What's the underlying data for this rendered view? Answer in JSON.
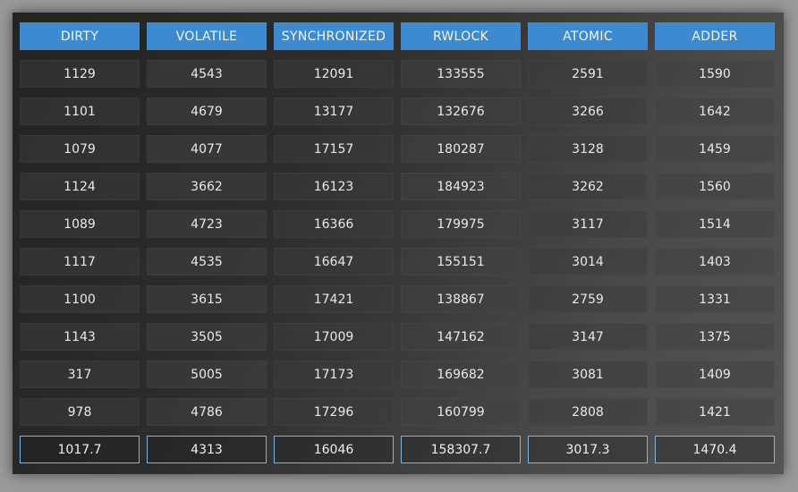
{
  "chart_data": {
    "type": "table",
    "columns": [
      "DIRTY",
      "VOLATILE",
      "SYNCHRONIZED",
      "RWLOCK",
      "ATOMIC",
      "ADDER"
    ],
    "rows": [
      [
        "1129",
        "4543",
        "12091",
        "133555",
        "2591",
        "1590"
      ],
      [
        "1101",
        "4679",
        "13177",
        "132676",
        "3266",
        "1642"
      ],
      [
        "1079",
        "4077",
        "17157",
        "180287",
        "3128",
        "1459"
      ],
      [
        "1124",
        "3662",
        "16123",
        "184923",
        "3262",
        "1560"
      ],
      [
        "1089",
        "4723",
        "16366",
        "179975",
        "3117",
        "1514"
      ],
      [
        "1117",
        "4535",
        "16647",
        "155151",
        "3014",
        "1403"
      ],
      [
        "1100",
        "3615",
        "17421",
        "138867",
        "2759",
        "1331"
      ],
      [
        "1143",
        "3505",
        "17009",
        "147162",
        "3147",
        "1375"
      ],
      [
        "317",
        "5005",
        "17173",
        "169682",
        "3081",
        "1409"
      ],
      [
        "978",
        "4786",
        "17296",
        "160799",
        "2808",
        "1421"
      ]
    ],
    "summary_row": [
      "1017.7",
      "4313",
      "16046",
      "158307.7",
      "3017.3",
      "1470.4"
    ]
  },
  "colors": {
    "header_bg": "#3d8ad0",
    "summary_border": "#7db4e0"
  }
}
